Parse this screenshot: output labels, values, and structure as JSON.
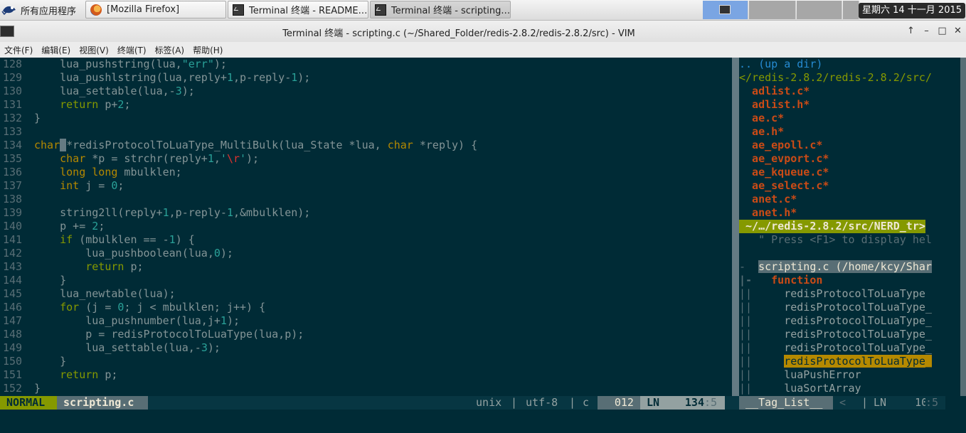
{
  "taskbar": {
    "start_label": "所有应用程序",
    "tasks": [
      {
        "label": "[Mozilla Firefox]",
        "icon": "firefox-icon"
      },
      {
        "label": "Terminal 终端 - README.…",
        "icon": "terminal-icon"
      },
      {
        "label": "Terminal 终端 - scripting.…",
        "icon": "terminal-icon"
      }
    ],
    "clock": "星期六 14 十一月 2015"
  },
  "window": {
    "title": "Terminal 终端 - scripting.c (~/Shared_Folder/redis-2.8.2/redis-2.8.2/src) - VIM",
    "buttons": [
      "↑",
      "–",
      "□",
      "✕"
    ]
  },
  "menu": [
    "文件(F)",
    "编辑(E)",
    "视图(V)",
    "终端(T)",
    "标签(A)",
    "帮助(H)"
  ],
  "editor": {
    "lines": [
      {
        "n": "128",
        "t": [
          [
            "    lua_pushstring(lua,",
            ""
          ],
          [
            "\"err\"",
            "st"
          ],
          [
            ");",
            ""
          ]
        ]
      },
      {
        "n": "129",
        "t": [
          [
            "    lua_pushlstring(lua,reply+",
            ""
          ],
          [
            "1",
            "nm"
          ],
          [
            ",p-reply-",
            ""
          ],
          [
            "1",
            "nm"
          ],
          [
            ");",
            ""
          ]
        ]
      },
      {
        "n": "130",
        "t": [
          [
            "    lua_settable(lua,-",
            ""
          ],
          [
            "3",
            "nm"
          ],
          [
            ");",
            ""
          ]
        ]
      },
      {
        "n": "131",
        "t": [
          [
            "    ",
            ""
          ],
          [
            "return",
            "kw"
          ],
          [
            " p+",
            ""
          ],
          [
            "2",
            "nm"
          ],
          [
            ";",
            ""
          ]
        ]
      },
      {
        "n": "132",
        "t": [
          [
            "}",
            ""
          ]
        ]
      },
      {
        "n": "133",
        "t": [
          [
            "",
            ""
          ]
        ]
      },
      {
        "n": "134",
        "t": [
          [
            "char",
            "ty"
          ],
          [
            " ",
            "cursor"
          ],
          [
            "*redisProtocolToLuaType_MultiBulk(lua_State *lua, ",
            ""
          ],
          [
            "char",
            "ty"
          ],
          [
            " *reply) {",
            ""
          ]
        ]
      },
      {
        "n": "135",
        "t": [
          [
            "    ",
            ""
          ],
          [
            "char",
            "ty"
          ],
          [
            " *p = strchr(reply+",
            ""
          ],
          [
            "1",
            "nm"
          ],
          [
            ",",
            ""
          ],
          [
            "'",
            "st"
          ],
          [
            "\\r",
            "esc"
          ],
          [
            "'",
            "st"
          ],
          [
            ");",
            ""
          ]
        ]
      },
      {
        "n": "136",
        "t": [
          [
            "    ",
            ""
          ],
          [
            "long long",
            "ty"
          ],
          [
            " mbulklen;",
            ""
          ]
        ]
      },
      {
        "n": "137",
        "t": [
          [
            "    ",
            ""
          ],
          [
            "int",
            "ty"
          ],
          [
            " j = ",
            ""
          ],
          [
            "0",
            "nm"
          ],
          [
            ";",
            ""
          ]
        ]
      },
      {
        "n": "138",
        "t": [
          [
            "",
            ""
          ]
        ]
      },
      {
        "n": "139",
        "t": [
          [
            "    string2ll(reply+",
            ""
          ],
          [
            "1",
            "nm"
          ],
          [
            ",p-reply-",
            ""
          ],
          [
            "1",
            "nm"
          ],
          [
            ",&mbulklen);",
            ""
          ]
        ]
      },
      {
        "n": "140",
        "t": [
          [
            "    p += ",
            ""
          ],
          [
            "2",
            "nm"
          ],
          [
            ";",
            ""
          ]
        ]
      },
      {
        "n": "141",
        "t": [
          [
            "    ",
            ""
          ],
          [
            "if",
            "kw"
          ],
          [
            " (mbulklen == -",
            ""
          ],
          [
            "1",
            "nm"
          ],
          [
            ") {",
            ""
          ]
        ]
      },
      {
        "n": "142",
        "t": [
          [
            "        lua_pushboolean(lua,",
            ""
          ],
          [
            "0",
            "nm"
          ],
          [
            ");",
            ""
          ]
        ]
      },
      {
        "n": "143",
        "t": [
          [
            "        ",
            ""
          ],
          [
            "return",
            "kw"
          ],
          [
            " p;",
            ""
          ]
        ]
      },
      {
        "n": "144",
        "t": [
          [
            "    }",
            ""
          ]
        ]
      },
      {
        "n": "145",
        "t": [
          [
            "    lua_newtable(lua);",
            ""
          ]
        ]
      },
      {
        "n": "146",
        "t": [
          [
            "    ",
            ""
          ],
          [
            "for",
            "kw"
          ],
          [
            " (j = ",
            ""
          ],
          [
            "0",
            "nm"
          ],
          [
            "; j < mbulklen; j++) {",
            ""
          ]
        ]
      },
      {
        "n": "147",
        "t": [
          [
            "        lua_pushnumber(lua,j+",
            ""
          ],
          [
            "1",
            "nm"
          ],
          [
            ");",
            ""
          ]
        ]
      },
      {
        "n": "148",
        "t": [
          [
            "        p = redisProtocolToLuaType(lua,p);",
            ""
          ]
        ]
      },
      {
        "n": "149",
        "t": [
          [
            "        lua_settable(lua,-",
            ""
          ],
          [
            "3",
            "nm"
          ],
          [
            ");",
            ""
          ]
        ]
      },
      {
        "n": "150",
        "t": [
          [
            "    }",
            ""
          ]
        ]
      },
      {
        "n": "151",
        "t": [
          [
            "    ",
            ""
          ],
          [
            "return",
            "kw"
          ],
          [
            " p;",
            ""
          ]
        ]
      },
      {
        "n": "152",
        "t": [
          [
            "}",
            ""
          ]
        ]
      }
    ]
  },
  "nerdtree": {
    "lines": [
      {
        "text": ".. (up a dir)",
        "color": "#268bd2"
      },
      {
        "text": "</redis-2.8.2/redis-2.8.2/src/",
        "color": "#859900"
      },
      {
        "text": "  adlist.c*",
        "color": "#cb4b16",
        "bold": true
      },
      {
        "text": "  adlist.h*",
        "color": "#cb4b16",
        "bold": true
      },
      {
        "text": "  ae.c*",
        "color": "#cb4b16",
        "bold": true
      },
      {
        "text": "  ae.h*",
        "color": "#cb4b16",
        "bold": true
      },
      {
        "text": "  ae_epoll.c*",
        "color": "#cb4b16",
        "bold": true
      },
      {
        "text": "  ae_evport.c*",
        "color": "#cb4b16",
        "bold": true
      },
      {
        "text": "  ae_kqueue.c*",
        "color": "#cb4b16",
        "bold": true
      },
      {
        "text": "  ae_select.c*",
        "color": "#cb4b16",
        "bold": true
      },
      {
        "text": "  anet.c*",
        "color": "#cb4b16",
        "bold": true
      },
      {
        "text": "  anet.h*",
        "color": "#cb4b16",
        "bold": true
      },
      {
        "text": " ~/…/redis-2.8.2/src/NERD_tr>",
        "color": "#eee8d5",
        "bg": "#859900",
        "bold": true
      },
      {
        "text": "   \" Press <F1> to display hel",
        "color": "#586e75"
      },
      {
        "text": "",
        "color": "#586e75"
      },
      {
        "text": "-  scripting.c (/home/kcy/Shar",
        "color": "#eee8d5",
        "hl": "scripting.c (/home/kcy/Shar",
        "hlbg": "#586e75"
      },
      {
        "text": "|-   function",
        "color": "#cb4b16",
        "bold": true,
        "prefixcolor": "#586e75"
      },
      {
        "text": "||     redisProtocolToLuaType",
        "color": "#93a1a1",
        "prefixcolor": "#586e75"
      },
      {
        "text": "||     redisProtocolToLuaType_",
        "color": "#93a1a1",
        "prefixcolor": "#586e75"
      },
      {
        "text": "||     redisProtocolToLuaType_",
        "color": "#93a1a1",
        "prefixcolor": "#586e75"
      },
      {
        "text": "||     redisProtocolToLuaType_",
        "color": "#93a1a1",
        "prefixcolor": "#586e75"
      },
      {
        "text": "||     redisProtocolToLuaType_",
        "color": "#93a1a1",
        "prefixcolor": "#586e75"
      },
      {
        "text": "||     redisProtocolToLuaType_",
        "color": "#002b36",
        "prefixcolor": "#586e75",
        "hl": "redisProtocolToLuaType_",
        "hlbg": "#b58900"
      },
      {
        "text": "||     luaPushError",
        "color": "#93a1a1",
        "prefixcolor": "#586e75"
      },
      {
        "text": "||     luaSortArray",
        "color": "#93a1a1",
        "prefixcolor": "#586e75"
      }
    ]
  },
  "statusline": {
    "mode": " NORMAL ",
    "file": " scripting.c ",
    "format": " unix ",
    "sep1": "|",
    "encoding": " utf-8 ",
    "sep2": "|",
    "filetype": " c ",
    "percent": " 012 ",
    "ln_label": " LN ",
    "line": "  134",
    "col": ":5 ",
    "tag_label": " __Tag_List__ ",
    "tag_sep": " < ",
    "tag_sep2": "|",
    "tag_ln": " LN ",
    "tag_line": "   10",
    "tag_col": ":5 "
  },
  "colors": {
    "background": "#002b36",
    "mode_bg": "#859900",
    "status_bg": "#586e75"
  }
}
